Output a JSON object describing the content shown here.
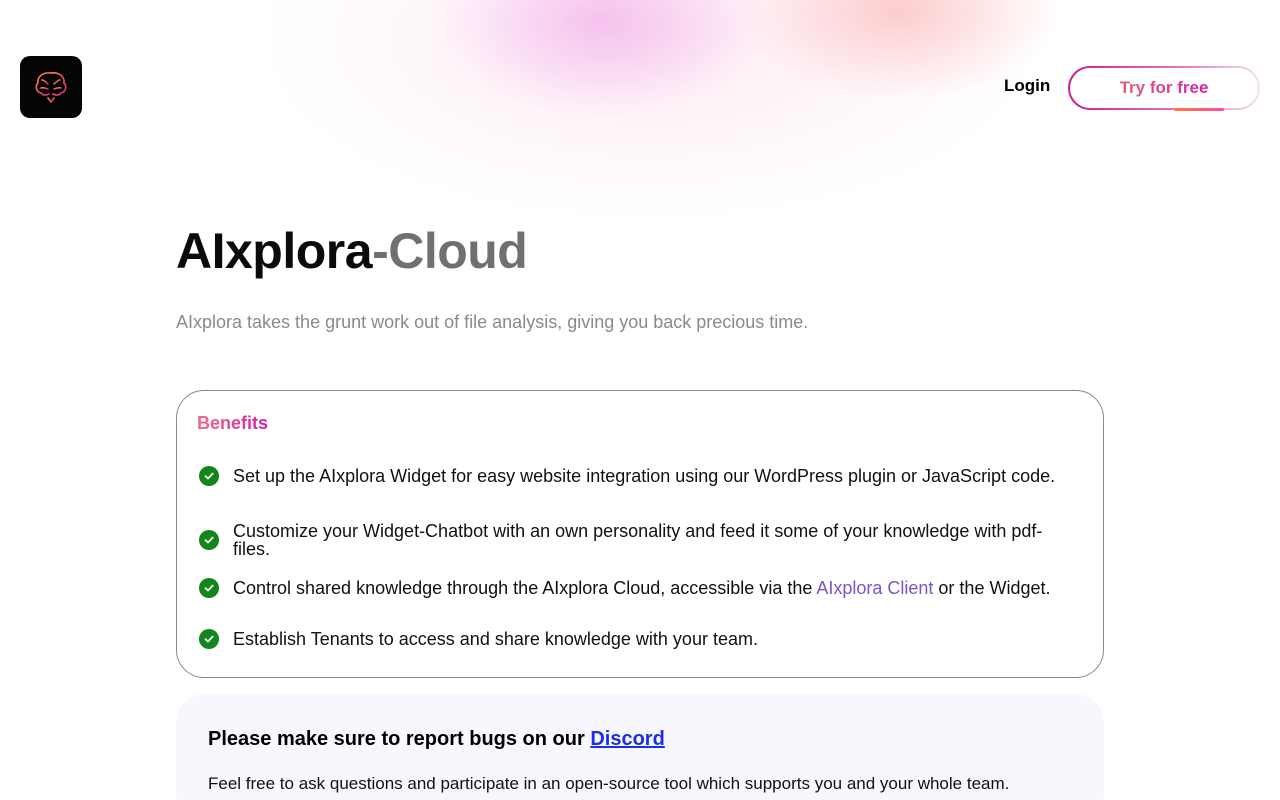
{
  "header": {
    "logo_icon": "brain-icon",
    "login_label": "Login",
    "cta_label": "Try for free"
  },
  "hero": {
    "title_main": "AIxplora",
    "title_suffix": "-Cloud",
    "subtitle": "AIxplora takes the grunt work out of file analysis, giving you back precious time."
  },
  "benefits": {
    "heading": "Benefits",
    "check_icon": "check-circle-icon",
    "items": [
      {
        "text": "Set up the AIxplora Widget for easy website integration using our WordPress plugin or JavaScript code."
      },
      {
        "text": "Customize your Widget-Chatbot with an own personality and feed it some of your knowledge with pdf-files."
      },
      {
        "before": "Control shared knowledge through the AIxplora Cloud, accessible via the ",
        "link": "AIxplora Client",
        "after": " or the Widget."
      },
      {
        "text": "Establish Tenants to access and share knowledge with your team."
      }
    ]
  },
  "notice": {
    "heading": "Please make sure to report bugs on our ",
    "link": "Discord",
    "body": "Feel free to ask questions and participate in an open-source tool which supports you and your whole team."
  },
  "colors": {
    "accent_pink": "#d21bae",
    "accent_coral": "#ef6d82",
    "check_green": "#13861a",
    "link_purple": "#7b54c8",
    "link_blue": "#1a2ee8"
  }
}
